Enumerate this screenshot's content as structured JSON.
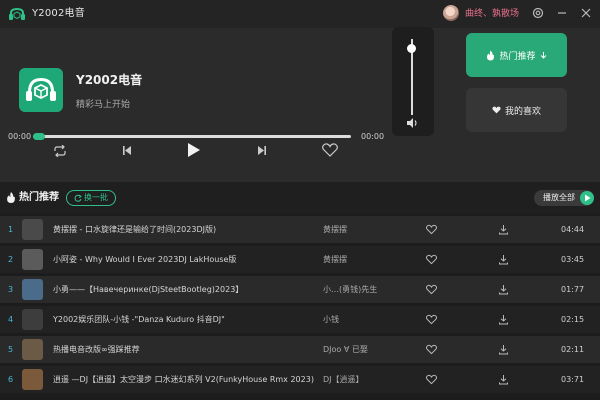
{
  "app": {
    "title": "Y2002电音"
  },
  "user": {
    "name": "曲终、孰散场"
  },
  "player": {
    "song_title": "Y2002电音",
    "song_subtitle": "精彩马上开始",
    "time_current": "00:00",
    "time_total": "00:00",
    "progress_fraction": 0,
    "volume_fraction": 0.88
  },
  "side_buttons": {
    "hot": "热门推荐",
    "favorite": "我的喜欢"
  },
  "section": {
    "title": "热门推荐",
    "refresh_label": "换一批",
    "play_all_label": "播放全部"
  },
  "colors": {
    "accent": "#2fc08a",
    "index": "#4cb7d9",
    "username": "#e86f8f"
  },
  "songs": [
    {
      "index": "1",
      "title": "黄摆摆 - 口水旋律还是输给了时间(2023DJ版)",
      "artist": "黄摆摆",
      "duration": "04:44",
      "thumb": "#4a4a4a"
    },
    {
      "index": "2",
      "title": "小阿姿 - Why Would I Ever 2023DJ LakHouse版",
      "artist": "黄摆摆",
      "duration": "03:45",
      "thumb": "#5b5b5b"
    },
    {
      "index": "3",
      "title": "小勇——【Навечеринке(DjSteetBootleg)2023】",
      "artist": "小…(勇钱)先生",
      "duration": "01:77",
      "thumb": "#4a6b8a"
    },
    {
      "index": "4",
      "title": "Y2002娱乐团队-小钱 -\"Danza Kuduro 抖音DJ\"",
      "artist": "小钱",
      "duration": "02:15",
      "thumb": "#3d3d3d"
    },
    {
      "index": "5",
      "title": "热播电音改版∞强踩推荐",
      "artist": "DJoo ∀ 已娶",
      "duration": "02:11",
      "thumb": "#6b5a45"
    },
    {
      "index": "6",
      "title": "逍遥 —DJ【逍遥】太空漫步 口水迷幻系列 V2(FunkyHouse Rmx 2023)",
      "artist": "DJ【逍遥】",
      "duration": "03:71",
      "thumb": "#7a5a3a"
    }
  ]
}
